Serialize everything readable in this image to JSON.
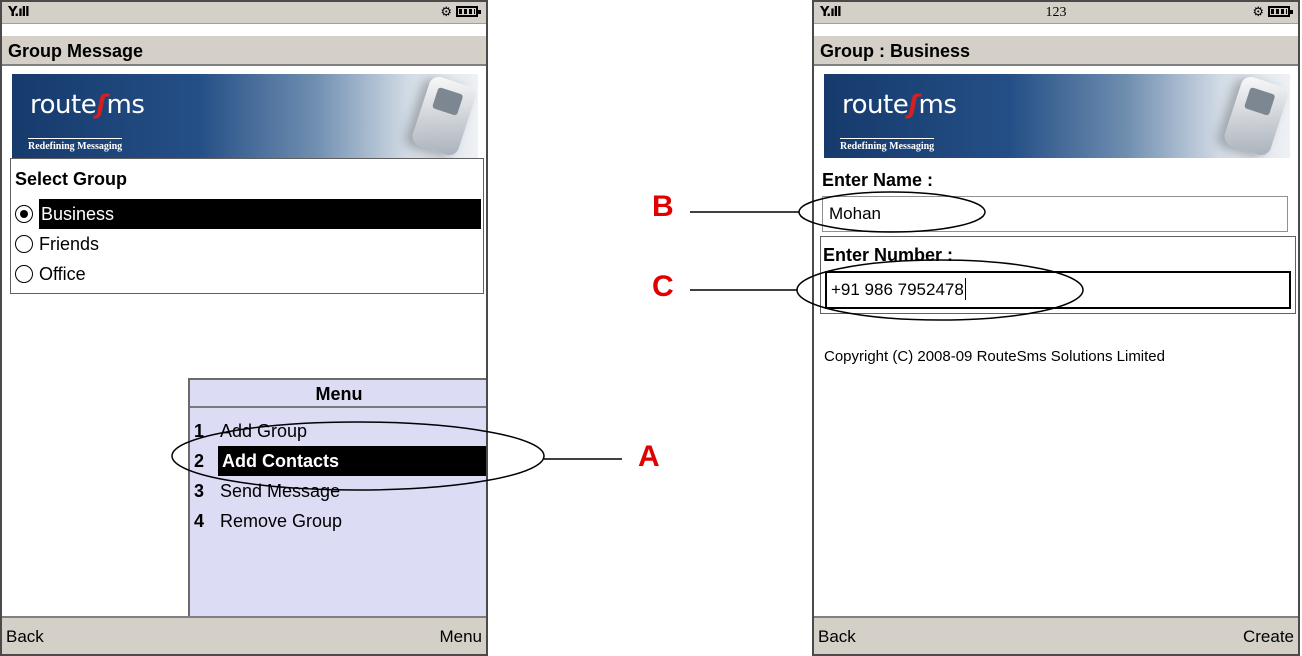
{
  "left_screen": {
    "status_bar": {
      "signal": "Y.ıll"
    },
    "title": "Group Message",
    "banner": {
      "logo_left": "route",
      "logo_right": "ms",
      "tagline": "Redefining Messaging"
    },
    "select_group": {
      "heading": "Select Group",
      "options": [
        {
          "label": "Business",
          "checked": true,
          "highlighted": true
        },
        {
          "label": "Friends",
          "checked": false,
          "highlighted": false
        },
        {
          "label": "Office",
          "checked": false,
          "highlighted": false
        }
      ]
    },
    "menu": {
      "title": "Menu",
      "items": [
        {
          "number": "1",
          "label": "Add Group"
        },
        {
          "number": "2",
          "label": "Add Contacts",
          "highlighted": true
        },
        {
          "number": "3",
          "label": "Send Message"
        },
        {
          "number": "4",
          "label": "Remove Group"
        }
      ]
    },
    "softkeys": {
      "left": "Back",
      "right": "Menu"
    }
  },
  "right_screen": {
    "status_bar": {
      "signal": "Y.ıll",
      "input_mode": "123"
    },
    "title": "Group : Business",
    "banner": {
      "logo_left": "route",
      "logo_right": "ms",
      "tagline": "Redefining Messaging"
    },
    "name_field": {
      "label": "Enter Name :",
      "value": "Mohan"
    },
    "number_field": {
      "label": "Enter Number :",
      "value": "+91 986 7952478"
    },
    "copyright": "Copyright (C) 2008-09 RouteSms Solutions Limited",
    "softkeys": {
      "left": "Back",
      "right": "Create"
    }
  },
  "callouts": {
    "a": "A",
    "b": "B",
    "c": "C",
    "color": "#e00000"
  }
}
